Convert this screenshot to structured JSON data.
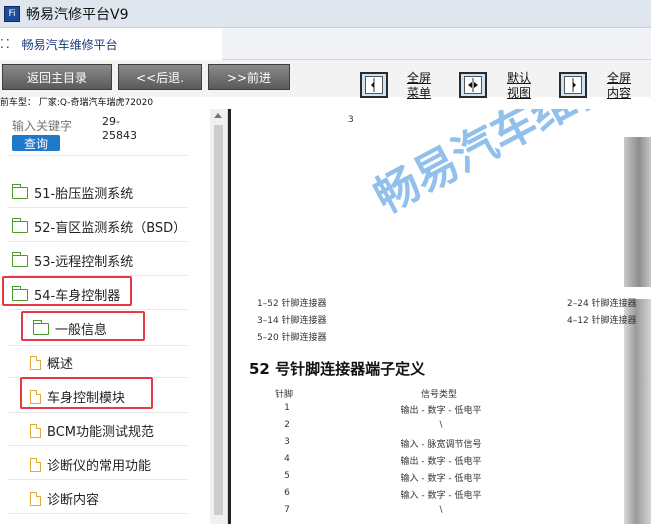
{
  "window": {
    "title": "畅易汽修平台V9",
    "icon_label": "Fi"
  },
  "tab": {
    "dots": "⁚⁚",
    "label": "畅易汽车维修平台"
  },
  "toolbar": {
    "back_main": "返回主目录",
    "back": "<<后退.",
    "forward": ">>前进",
    "view_buttons": [
      {
        "icon": "fullscreen-menu-icon",
        "label_top": "全屏",
        "label_bottom": "菜单"
      },
      {
        "icon": "default-view-icon",
        "label_top": "默认",
        "label_bottom": "视图"
      },
      {
        "icon": "fullscreen-content-icon",
        "label_top": "全屏",
        "label_bottom": "内容"
      }
    ]
  },
  "status": {
    "text": "前车型：  厂家:Q-奇瑞汽车瑞虎72020"
  },
  "search": {
    "placeholder": "输入关键字",
    "value_line1": "29-",
    "value_line2": "25843",
    "button": "查询"
  },
  "tree": [
    {
      "type": "folder",
      "label": "51-胎压监测系统"
    },
    {
      "type": "folder",
      "label": "52-盲区监测系统（BSD）"
    },
    {
      "type": "folder",
      "label": "53-远程控制系统"
    },
    {
      "type": "folder",
      "label": "54-车身控制器",
      "open": true,
      "highlighted": true
    },
    {
      "type": "folder",
      "label": "一般信息",
      "open": true,
      "highlighted": true
    },
    {
      "type": "file",
      "label": "概述"
    },
    {
      "type": "file",
      "label": "车身控制模块",
      "highlighted": true
    },
    {
      "type": "file",
      "label": "BCM功能测试规范"
    },
    {
      "type": "file",
      "label": "诊断仪的常用功能"
    },
    {
      "type": "file",
      "label": "诊断内容"
    }
  ],
  "document": {
    "page_number": "3",
    "watermark": "畅易汽车维修",
    "connectors_left": [
      "1–52  针脚连接器",
      "3–14  针脚连接器",
      "5–20  针脚连接器"
    ],
    "connectors_right": [
      "2–24  针脚连接器",
      "4–12  针脚连接器"
    ],
    "section_title": "52  号针脚连接器端子定义",
    "table_headers": {
      "pin": "针脚",
      "signal": "信号类型"
    },
    "rows": [
      {
        "pin": "1",
        "signal": "输出 - 数字 - 低电平"
      },
      {
        "pin": "2",
        "signal": "\\"
      },
      {
        "pin": "3",
        "signal": "输入 - 脉宽调节信号"
      },
      {
        "pin": "4",
        "signal": "输出 - 数字 - 低电平"
      },
      {
        "pin": "5",
        "signal": "输入 - 数字 - 低电平"
      },
      {
        "pin": "6",
        "signal": "输入 - 数字 - 低电平"
      },
      {
        "pin": "7",
        "signal": "\\"
      }
    ]
  },
  "colors": {
    "highlight": "#e63946",
    "watermark": "#7fb6ea",
    "search_button": "#1f78c8",
    "folder": "#4b9a2b",
    "file": "#e0a93a"
  }
}
